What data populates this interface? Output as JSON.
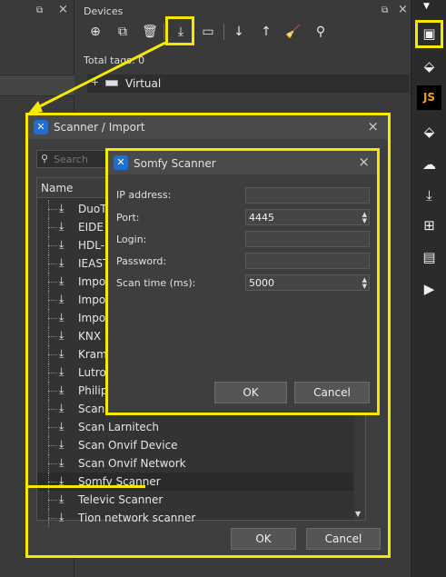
{
  "devices_panel": {
    "title": "Devices",
    "total_tags": "Total tags: 0",
    "tree_root": "Virtual"
  },
  "scanner_dialog": {
    "title": "Scanner / Import",
    "search_placeholder": "Search",
    "column_header": "Name",
    "items": [
      "DuoT",
      "EIDE n",
      "HDL-",
      "IEAST",
      "Impor",
      "Impor",
      "Impor",
      "KNX (",
      "Kramo",
      "Lutron",
      "Philip",
      "Scan l",
      "Scan Larnitech",
      "Scan Onvif Device",
      "Scan Onvif Network",
      "Somfy Scanner",
      "Televic Scanner",
      "Tion network scanner"
    ],
    "selected_item": "Somfy Scanner",
    "ok_label": "OK",
    "cancel_label": "Cancel"
  },
  "somfy_dialog": {
    "title": "Somfy Scanner",
    "fields": {
      "ip_label": "IP address:",
      "ip_value": "",
      "port_label": "Port:",
      "port_value": "4445",
      "login_label": "Login:",
      "login_value": "",
      "password_label": "Password:",
      "password_value": "",
      "scan_time_label": "Scan time (ms):",
      "scan_time_value": "5000"
    },
    "ok_label": "OK",
    "cancel_label": "Cancel"
  },
  "right_toolbar": {
    "js_label": "JS"
  },
  "colors": {
    "highlight": "#f5e900",
    "panel_bg": "#3a3a3a",
    "dialog_bg": "#3e3e3e"
  }
}
